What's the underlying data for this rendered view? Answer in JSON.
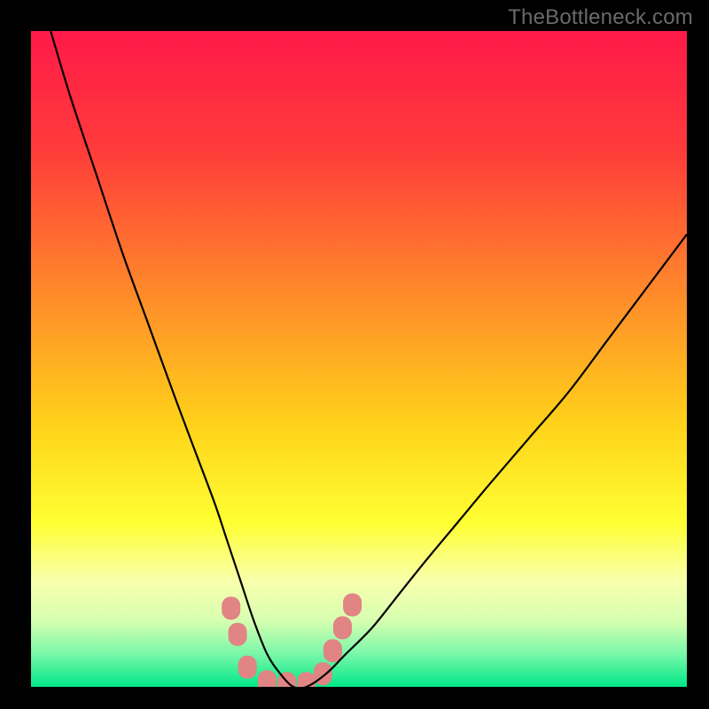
{
  "watermark": "TheBottleneck.com",
  "chart_data": {
    "type": "line",
    "title": "",
    "xlabel": "",
    "ylabel": "",
    "xlim": [
      0,
      100
    ],
    "ylim": [
      0,
      100
    ],
    "grid": false,
    "legend": {
      "visible": false
    },
    "background_gradient_stops": [
      {
        "pct": 0,
        "color": "#ff1a49"
      },
      {
        "pct": 18,
        "color": "#ff3b3b"
      },
      {
        "pct": 40,
        "color": "#ff8a2a"
      },
      {
        "pct": 60,
        "color": "#ffd21a"
      },
      {
        "pct": 75,
        "color": "#ffff33"
      },
      {
        "pct": 84,
        "color": "#f8ffae"
      },
      {
        "pct": 90,
        "color": "#d6ffb0"
      },
      {
        "pct": 95,
        "color": "#79f7a9"
      },
      {
        "pct": 100,
        "color": "#00e888"
      }
    ],
    "series": [
      {
        "name": "bottleneck-curve",
        "color": "#000000",
        "stroke_width": 2.2,
        "x": [
          3,
          6,
          10,
          14,
          18,
          22,
          25,
          28,
          30,
          32,
          34,
          36,
          38,
          40,
          42,
          45,
          48,
          52,
          56,
          60,
          65,
          70,
          76,
          82,
          88,
          94,
          100
        ],
        "y": [
          100,
          90,
          78,
          66,
          55,
          44,
          36,
          28,
          22,
          16,
          10,
          5,
          2,
          0,
          0,
          2,
          5,
          9,
          14,
          19,
          25,
          31,
          38,
          45,
          53,
          61,
          69
        ]
      }
    ],
    "markers": {
      "name": "highlight-dots",
      "color": "#e08484",
      "radius": 10,
      "points": [
        {
          "x": 30.5,
          "y": 12
        },
        {
          "x": 31.5,
          "y": 8
        },
        {
          "x": 33.0,
          "y": 3
        },
        {
          "x": 36.0,
          "y": 0.8
        },
        {
          "x": 39.0,
          "y": 0.5
        },
        {
          "x": 42.0,
          "y": 0.5
        },
        {
          "x": 44.5,
          "y": 2.0
        },
        {
          "x": 46.0,
          "y": 5.5
        },
        {
          "x": 47.5,
          "y": 9.0
        },
        {
          "x": 49.0,
          "y": 12.5
        }
      ]
    }
  }
}
